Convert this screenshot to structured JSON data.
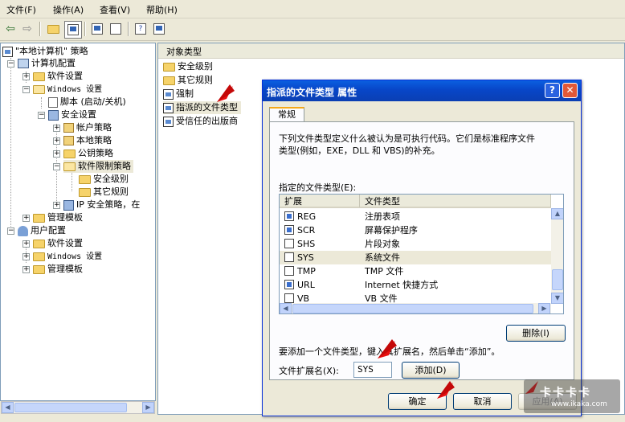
{
  "menu": [
    "文件(F)",
    "操作(A)",
    "查看(V)",
    "帮助(H)"
  ],
  "tree": {
    "root": "\"本地计算机\" 策略",
    "computer_config": "计算机配置",
    "software_settings": "软件设置",
    "windows_settings": "Windows 设置",
    "scripts": "脚本 (启动/关机)",
    "security_settings": "安全设置",
    "account_policy": "帐户策略",
    "local_policy": "本地策略",
    "public_key_policy": "公钥策略",
    "software_restriction": "软件限制策略",
    "security_level": "安全级别",
    "other_rules": "其它规则",
    "ip_security": "IP 安全策略，在",
    "admin_templates": "管理模板",
    "user_config": "用户配置",
    "user_software_settings": "软件设置",
    "user_windows_settings": "Windows 设置",
    "user_admin_templates": "管理模板"
  },
  "right_pane": {
    "header": "对象类型",
    "items": [
      "安全级别",
      "其它规则",
      "强制",
      "指派的文件类型",
      "受信任的出版商"
    ]
  },
  "dialog": {
    "title": "指派的文件类型 属性",
    "help": "?",
    "close": "✕",
    "tab": "常规",
    "description_line1": "下列文件类型定义什么被认为是可执行代码。它们是标准程序文件",
    "description_line2": "类型(例如，EXE，DLL 和 VBS)的补充。",
    "list_label": "指定的文件类型(E):",
    "col_ext": "扩展",
    "col_type": "文件类型",
    "rows": [
      {
        "ext": "REG",
        "type": "注册表项"
      },
      {
        "ext": "SCR",
        "type": "屏幕保护程序"
      },
      {
        "ext": "SHS",
        "type": "片段对象"
      },
      {
        "ext": "SYS",
        "type": "系统文件"
      },
      {
        "ext": "TMP",
        "type": "TMP 文件"
      },
      {
        "ext": "URL",
        "type": "Internet 快捷方式"
      },
      {
        "ext": "VB",
        "type": "VB 文件"
      }
    ],
    "delete_btn": "删除(I)",
    "add_instruction": "要添加一个文件类型，键入其扩展名，然后单击“添加”。",
    "ext_label": "文件扩展名(X):",
    "ext_value": "SYS",
    "add_btn": "添加(D)",
    "ok_btn": "确定",
    "cancel_btn": "取消",
    "apply_btn": "应用(A)"
  },
  "watermark": {
    "main": "卡卡卡卡",
    "url": "www.ikaka.com"
  },
  "colors": {
    "accent_arrow": "#e81010",
    "titlebar": "#0846c8"
  }
}
